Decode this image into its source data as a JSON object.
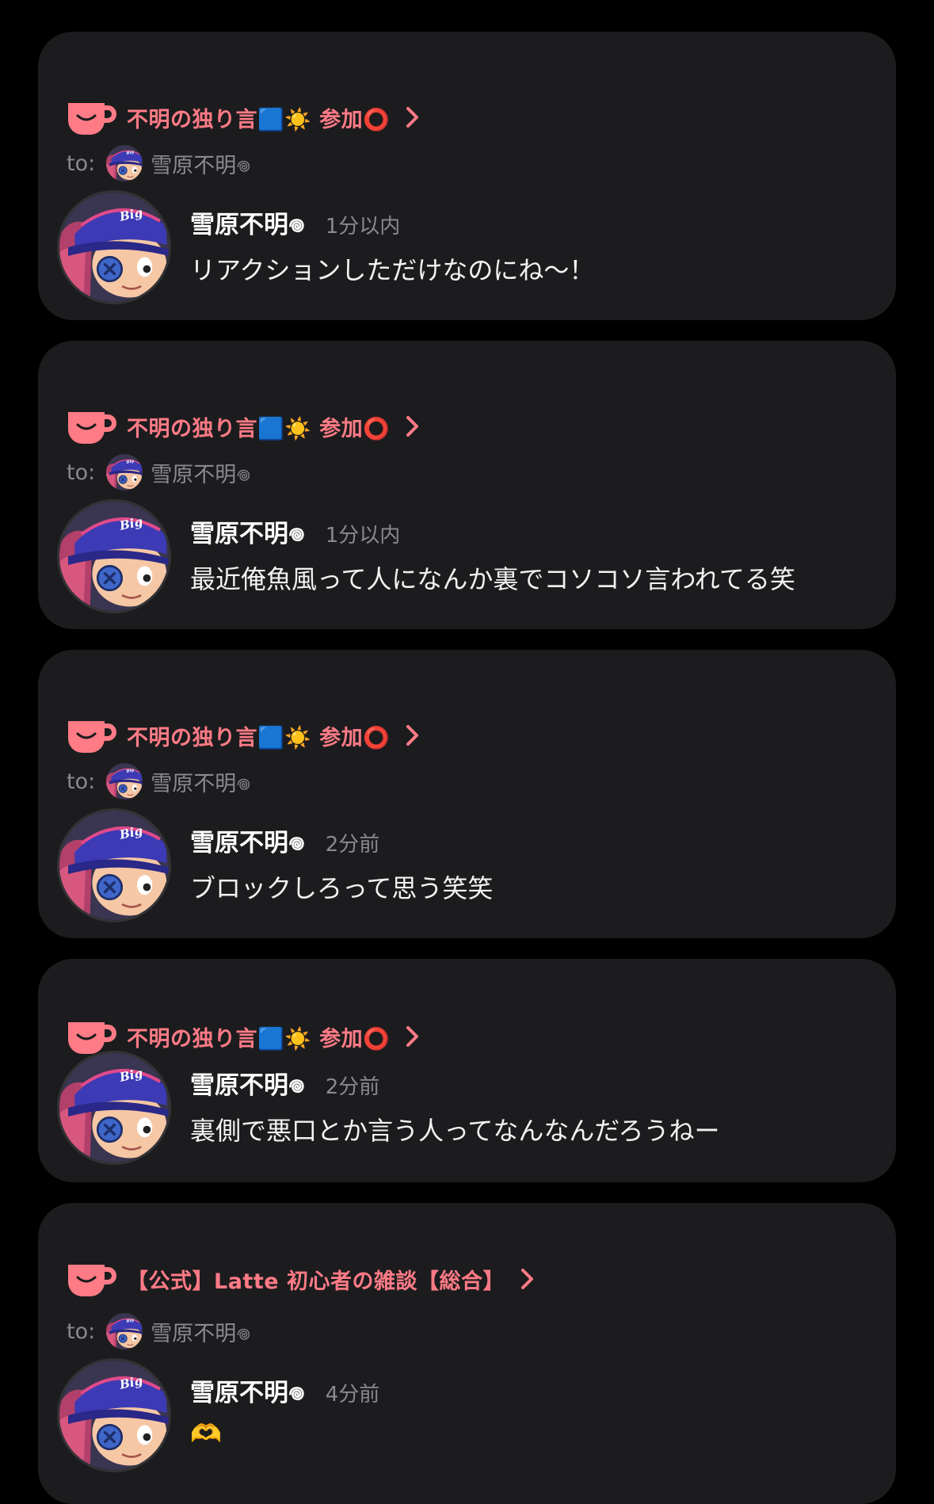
{
  "colors": {
    "background": "#000000",
    "card": "#1c1c1e",
    "accent": "#ff7b86",
    "muted_text": "#8a8a8e",
    "primary_text": "#ffffff"
  },
  "posts": [
    {
      "channel": "不明の独り言🟦☀️ 参加⭕️",
      "to_label": "to:",
      "to_name": "雪原不明𖦹",
      "author": "雪原不明𖦹",
      "time": "1分以内",
      "message": "リアクションしただけなのにね〜！"
    },
    {
      "channel": "不明の独り言🟦☀️ 参加⭕️",
      "to_label": "to:",
      "to_name": "雪原不明𖦹",
      "author": "雪原不明𖦹",
      "time": "1分以内",
      "message": "最近俺魚風って人になんか裏でコソコソ言われてる笑"
    },
    {
      "channel": "不明の独り言🟦☀️ 参加⭕️",
      "to_label": "to:",
      "to_name": "雪原不明𖦹",
      "author": "雪原不明𖦹",
      "time": "2分前",
      "message": "ブロックしろって思う笑笑"
    },
    {
      "channel": "不明の独り言🟦☀️ 参加⭕️",
      "author": "雪原不明𖦹",
      "time": "2分前",
      "message": "裏側で悪口とか言う人ってなんなんだろうねー"
    },
    {
      "channel": "【公式】Latte 初心者の雑談【総合】",
      "to_label": "to:",
      "to_name": "雪原不明𖦹",
      "author": "雪原不明𖦹",
      "time": "4分前",
      "message": "🫶"
    }
  ]
}
